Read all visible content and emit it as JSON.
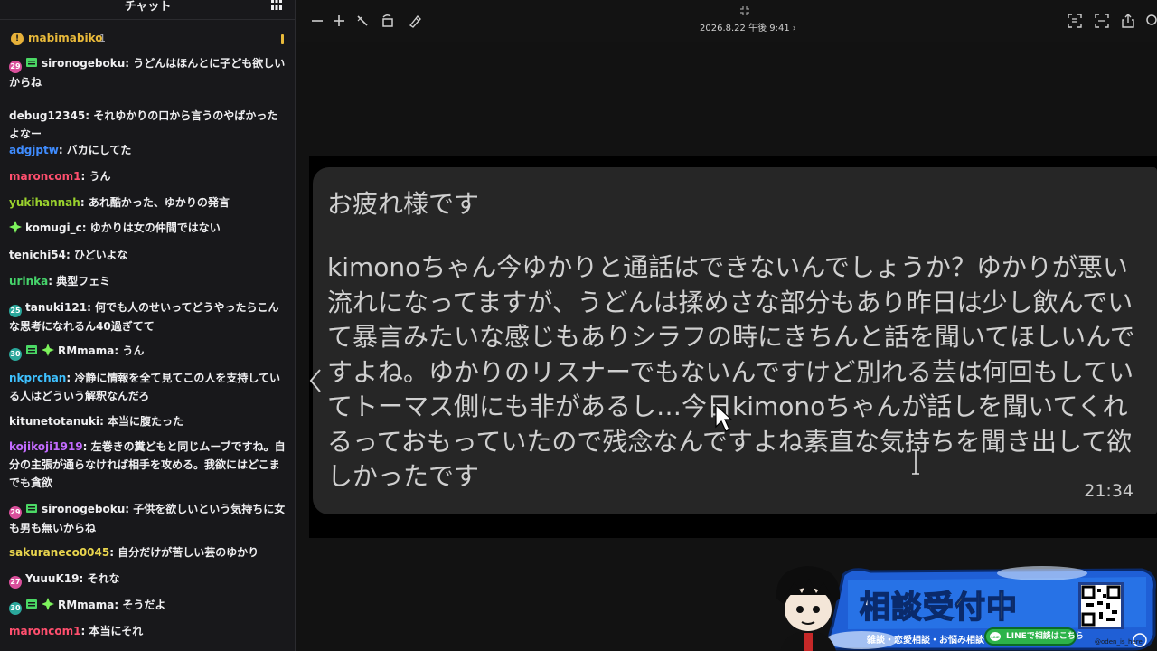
{
  "chat": {
    "title": "チャット",
    "pinned": {
      "user": "mabimabiko",
      "count": "1",
      "badge": "!"
    },
    "messages": [
      {
        "user": "sironogeboku",
        "color": "#efeff1",
        "text": "うどんはほんとに子ども欲しいからね",
        "badges": [
          "sub-pink:29",
          "mod"
        ]
      },
      {
        "user": "debug12345",
        "color": "#efeff1",
        "text": "それゆかりの口から言うのやばかったよなー",
        "badges": []
      },
      {
        "user": "adgjptw",
        "color": "#3f8cff",
        "text": "バカにしてた",
        "badges": []
      },
      {
        "user": "maroncom1",
        "color": "#ff4f6e",
        "text": "うん",
        "badges": []
      },
      {
        "user": "yukihannah",
        "color": "#9ad22d",
        "text": "あれ酷かった、ゆかりの発言",
        "badges": []
      },
      {
        "user": "komugi_c",
        "color": "#efeff1",
        "text": "ゆかりは女の仲間ではない",
        "badges": [
          "star"
        ]
      },
      {
        "user": "tenichi54",
        "color": "#efeff1",
        "text": "ひどいよな",
        "badges": []
      },
      {
        "user": "urinka",
        "color": "#46d46b",
        "text": "典型フェミ",
        "badges": []
      },
      {
        "user": "tanuki121",
        "color": "#efeff1",
        "text": "何でも人のせいってどうやったらこんな思考になれるん40過ぎてて",
        "badges": [
          "sub-teal:25"
        ]
      },
      {
        "user": "RMmama",
        "color": "#efeff1",
        "text": "うん",
        "badges": [
          "sub-teal:30",
          "mod",
          "star"
        ]
      },
      {
        "user": "nkprchan",
        "color": "#3ec1ff",
        "text": "冷静に情報を全て見てこの人を支持している人はどういう解釈なんだろ",
        "badges": []
      },
      {
        "user": "kitunetotanuki",
        "color": "#efeff1",
        "text": "本当に腹たった",
        "badges": []
      },
      {
        "user": "kojikoji1919",
        "color": "#c36bff",
        "text": "左巻きの糞どもと同じムーブですね。自分の主張が通らなければ相手を攻める。我欲にはどこまでも貪欲",
        "badges": []
      },
      {
        "user": "sironogeboku",
        "color": "#efeff1",
        "text": "子供を欲しいという気持ちに女も男も無いからね",
        "badges": [
          "sub-pink:29",
          "mod"
        ]
      },
      {
        "user": "sakuraneco0045",
        "color": "#e8d44d",
        "text": "自分だけが苦しい芸のゆかり",
        "badges": []
      },
      {
        "user": "YuuuK19",
        "color": "#efeff1",
        "text": "それな",
        "badges": [
          "sub-pink:27"
        ]
      },
      {
        "user": "RMmama",
        "color": "#efeff1",
        "text": "そうだよ",
        "badges": [
          "sub-teal:30",
          "mod",
          "star"
        ]
      },
      {
        "user": "maroncom1",
        "color": "#ff4f6e",
        "text": "本当にそれ",
        "badges": []
      }
    ]
  },
  "viewer": {
    "timestamp": "2026.8.22 午後 9:41",
    "toolbar": [
      "zoom-out-icon",
      "zoom-in-icon",
      "markup-icon",
      "rotate-icon",
      "annotate-icon",
      "crop-icon",
      "fullscreen-icon",
      "share-icon",
      "more-icon"
    ],
    "message": {
      "greeting": "お疲れ様です",
      "body": "kimonoちゃん今ゆかりと通話はできないんでしょうか？ゆかりが悪い流れになってますが、うどんは揉めさな部分もあり昨日は少し飲んでいて暴言みたいな感じもありシラフの時にきちんと話を聞いてほしいんですよね。ゆかりのリスナーでもないんですけど別れる芸は何回もしていてトーマス側にも非があるし…今日kimonoちゃんが話しを聞いてくれるっておもっていたので残念なんですよね素直な気持ちを聞き出して欲しかったです",
      "time": "21:34"
    }
  },
  "banner": {
    "title_a": "相談",
    "title_b": "受付中",
    "subtitle": "雑談・恋愛相談・お悩み相談",
    "line_button": "LINEで相談はこちら",
    "handle": "@oden_is_here"
  },
  "colors": {
    "chat_bg": "#18181b",
    "viewer_bg": "#121212",
    "bubble_bg": "#262626",
    "accent": "#e8b93a"
  }
}
